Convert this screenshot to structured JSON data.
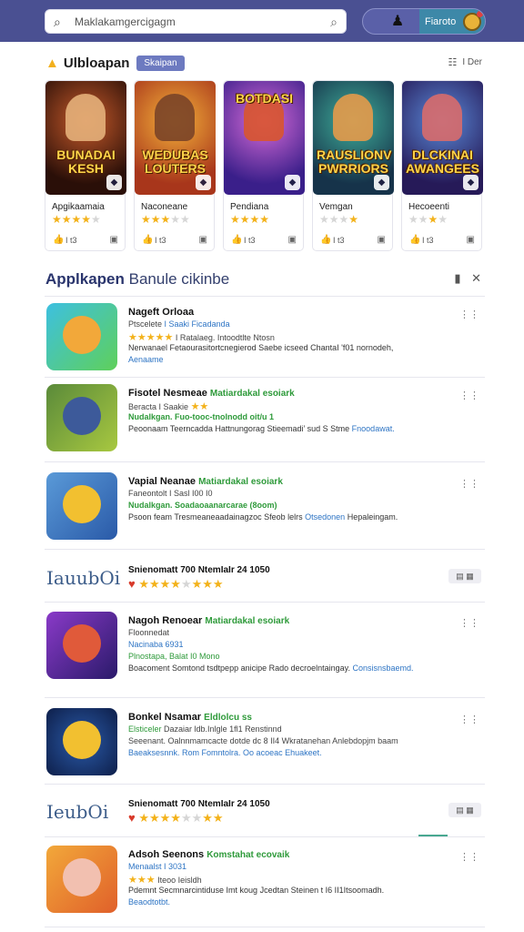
{
  "search": {
    "text": "Maklakamgercigagm"
  },
  "account": {
    "button_label": "Fiaroto"
  },
  "featured": {
    "title": "Ulbloapan",
    "badge": "Skaipan",
    "view_label": "I Der",
    "cards": [
      {
        "caption": "BUNADAI\nKESH",
        "name": "Apgikaamaia",
        "rating": 4,
        "stat": "I t3"
      },
      {
        "caption": "WEDUBAS\nLOUTERS",
        "name": "Naconeane",
        "rating": 3,
        "stat": "I t3"
      },
      {
        "caption": "BOTDASI",
        "name": "Pendiana",
        "rating": 4,
        "stat": "I t3"
      },
      {
        "caption": "RAUSLIONV\nPWRRIORS",
        "name": "Vemgan",
        "rating": 1,
        "stat": "I t3"
      },
      {
        "caption": "DLCKINAI\nAWANGEES",
        "name": "Hecoeenti",
        "rating": 2,
        "stat": "I t3"
      }
    ]
  },
  "list": {
    "title": "Applkapen",
    "subtitle": "Banule cikinbe",
    "items": [
      {
        "title": "Nageft Orloaa",
        "tag": "",
        "line2a": "Ptscelete",
        "line2b": "I Saaki Ficadanda",
        "stars": 5,
        "line3": "I Ratalaeg. Intoodtlte Ntosn",
        "desc": "Nerwanael Fetaourasitortcnegierod Saebe icseed ChantaI 'f01 nornodeh,",
        "link": "Aenaame"
      },
      {
        "title": "Fisotel Nesmeae",
        "tag": "Matiardakal esoiark",
        "line2a": "Beracta I Saakie",
        "line2b": "",
        "stars": 0,
        "line3": "Nudalkgan. Fuo-tooc-tnolnodd oit/u 1",
        "desc": "Peoonaam Teerncadda Hattnungorag Stieemadi’ sud S Stme",
        "link": "Fnoodawat."
      },
      {
        "title": "Vapial Neanae",
        "tag": "Matiardakal esoiark",
        "line2a": "Faneontolt I Sasl I00 I0",
        "line2b": "",
        "stars": 0,
        "line3": "Nudalkgan. Soadaoaanarcarae (8oom)",
        "desc": "Psoon feam Tresmeaneaadainagzoc Sfeob lelrs",
        "link": "Otsedonen",
        "desc2": "Hepaleingam."
      },
      {
        "title": "Nagoh Renoear",
        "tag": "Matiardakal esoiark",
        "line2a": "Floonnedat",
        "line2b": "",
        "stars": 0,
        "line3": "Nacinaba 6931",
        "line3b": "Plnostapa, Balat I0 Mono",
        "desc": "Boacoment Somtond tsdtpepp anicipe Rado decroelntaingay.",
        "link": "Consisnsbaemd."
      },
      {
        "title": "Bonkel Nsamar",
        "tag": "Eldlolcu ss",
        "line2a": "Elsticeler",
        "line2b": "Dazaiar ldb.Inlgle 1fl1 Renstinnd",
        "stars": 0,
        "line3": "Seeenant. Oalnnmamcacte dotde dc 8 II4 Wkratanehan Anlebdopjm baam",
        "desc": "Baeaksesnnk. Rom Fomntolra. Oo acoeac Ehuakeet.",
        "link": ""
      },
      {
        "title": "Adsoh Seenons",
        "tag": "Komstahat ecovaik",
        "line2a": "Menaalst I 3031",
        "line2b": "",
        "stars": 3,
        "line3": "Iteoo Ieisldh",
        "desc": "Pdemnt Secmnarcintiduse Imt koug Jcedtan Steinen t I6 II1Itsoomadh.",
        "link": "Beaodtotbt."
      }
    ],
    "promos": [
      {
        "logo": "IauubOi",
        "title": "Snienomatt 700 NtemIaIr 24 1050",
        "rating": 6
      },
      {
        "logo": "IeubOi",
        "title": "Snienomatt 700 NtemIaIr 24 1050",
        "rating": 5
      }
    ],
    "promo_button": "▤ ▦"
  },
  "colors": {
    "header": "#4a5092",
    "accent_green": "#2e9a3a",
    "link_blue": "#2d74c4",
    "star": "#f3b21b"
  }
}
